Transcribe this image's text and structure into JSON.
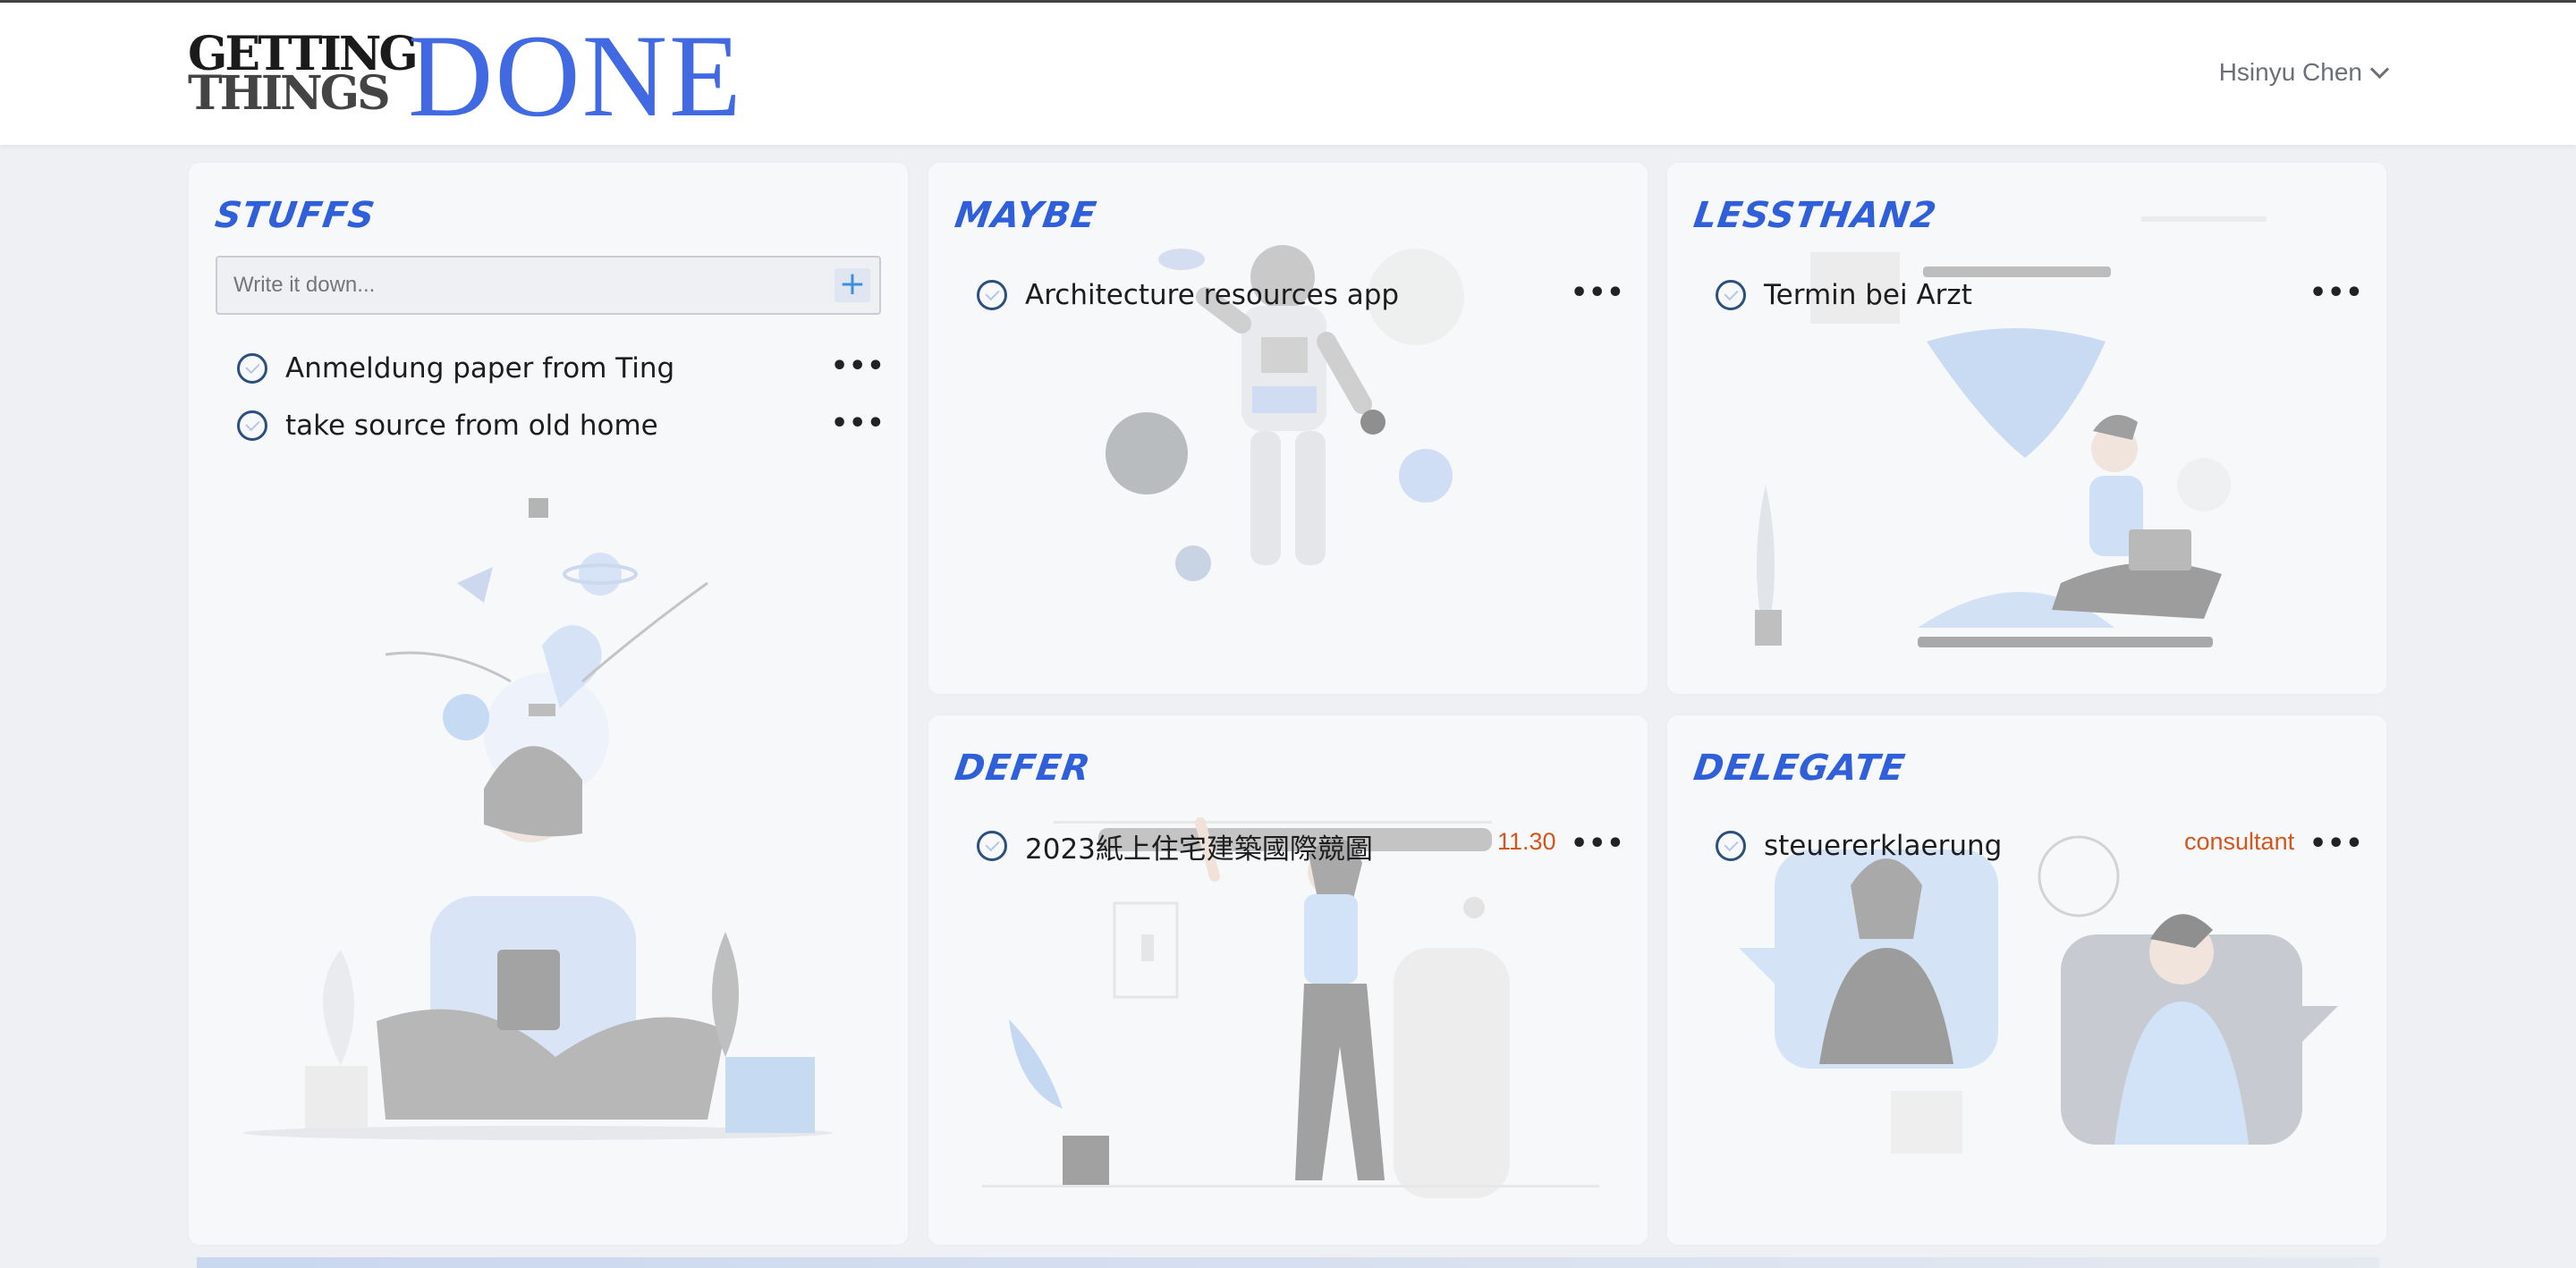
{
  "header": {
    "logo": {
      "line1": "GETTING",
      "line2": "THINGS",
      "big": "DONE"
    },
    "user_name": "Hsinyu Chen"
  },
  "stuffs": {
    "title": "STUFFS",
    "input_placeholder": "Write it down...",
    "add_label": "+",
    "tasks": [
      {
        "text": "Anmeldung paper from Ting"
      },
      {
        "text": "take source from old home"
      }
    ]
  },
  "maybe": {
    "title": "MAYBE",
    "tasks": [
      {
        "text": "Architecture resources app"
      }
    ]
  },
  "lessthan2": {
    "title": "LESSTHAN2",
    "tasks": [
      {
        "text": "Termin bei Arzt"
      }
    ]
  },
  "defer": {
    "title": "DEFER",
    "tasks": [
      {
        "text": "2023紙上住宅建築國際競圖",
        "date": "11.30"
      }
    ]
  },
  "delegate": {
    "title": "DELEGATE",
    "tasks": [
      {
        "text": "steuererklaerung",
        "person": "consultant"
      }
    ]
  },
  "menu_label": "•••",
  "colors": {
    "accent": "#2f5fd9",
    "logo_blue": "#4169e1",
    "tag_orange": "#d2561e"
  }
}
